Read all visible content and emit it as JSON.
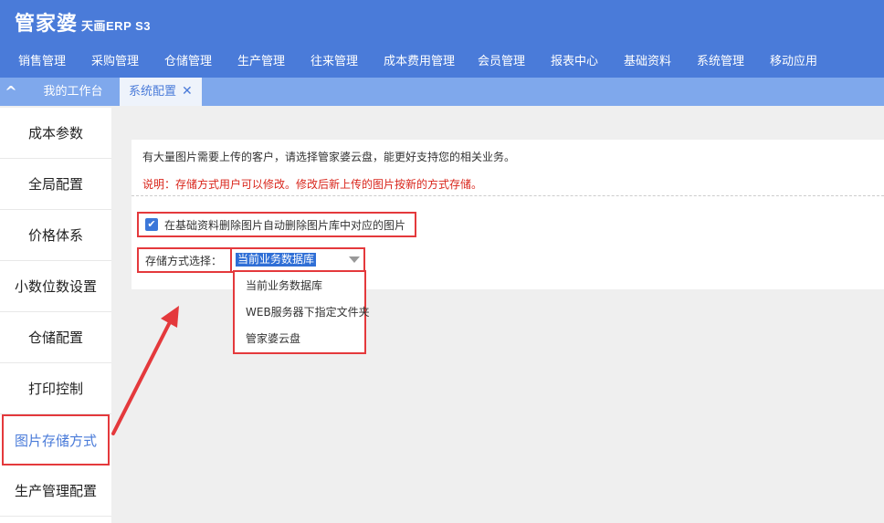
{
  "brand": {
    "name": "管家婆",
    "product": "天画ERP S3"
  },
  "mainnav": [
    "销售管理",
    "采购管理",
    "仓储管理",
    "生产管理",
    "往来管理",
    "成本费用管理",
    "会员管理",
    "报表中心",
    "基础资料",
    "系统管理",
    "移动应用"
  ],
  "tabs": {
    "home": "我的工作台",
    "active": "系统配置",
    "close": "✕"
  },
  "sidebar": [
    "成本参数",
    "全局配置",
    "价格体系",
    "小数位数设置",
    "仓储配置",
    "打印控制",
    "图片存储方式",
    "生产管理配置"
  ],
  "panel": {
    "info": "有大量图片需要上传的客户，请选择管家婆云盘，能更好支持您的相关业务。",
    "note": "说明：存储方式用户可以修改。修改后新上传的图片按新的方式存储。",
    "checkbox_label": "在基础资料删除图片自动删除图片库中对应的图片",
    "checkbox_checked": true,
    "storage_label": "存储方式选择：",
    "storage_selected": "当前业务数据库",
    "storage_options": [
      "当前业务数据库",
      "WEB服务器下指定文件夹",
      "管家婆云盘"
    ]
  },
  "colors": {
    "brand": "#4a7bd9",
    "tabbar": "#7fa8ec",
    "highlight": "#e4393c",
    "note": "#d9261c"
  }
}
